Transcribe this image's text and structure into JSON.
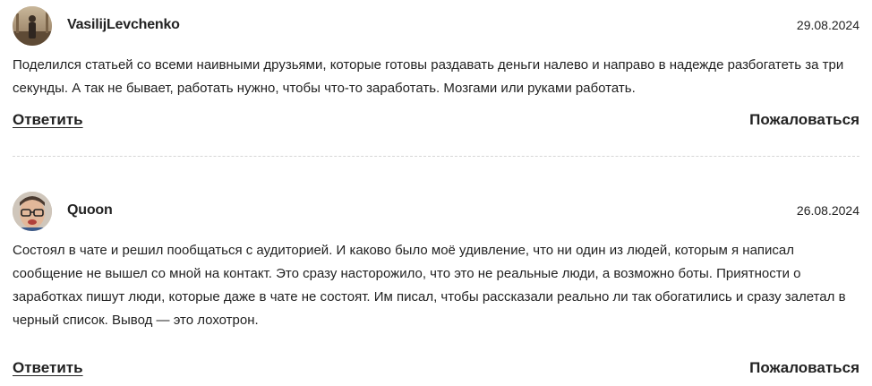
{
  "comments": [
    {
      "author": "VasilijLevchenko",
      "date": "29.08.2024",
      "avatar_icon": "user-photo-icon",
      "text": "Поделился статьей со всеми наивными друзьями, которые готовы раздавать деньги налево и направо в надежде разбогатеть за три секунды. А так не бывает, работать нужно, чтобы что-то заработать. Мозгами или руками работать.",
      "reply_label": "Ответить",
      "report_label": "Пожаловаться"
    },
    {
      "author": "Quoon",
      "date": "26.08.2024",
      "avatar_icon": "user-photo-icon",
      "text": "Состоял в чате и решил пообщаться с аудиторией. И каково было моё удивление, что ни один из людей, которым я написал сообщение не вышел со мной на контакт. Это сразу насторожило, что это не реальные люди, а возможно боты. Приятности о заработках пишут люди, которые даже в чате не состоят. Им писал, чтобы рассказали реально ли так обогатились и сразу залетал в черный список. Вывод — это лохотрон.",
      "reply_label": "Ответить",
      "report_label": "Пожаловаться"
    }
  ],
  "colors": {
    "text": "#222222",
    "divider": "#d6d6d6",
    "background": "#ffffff"
  }
}
